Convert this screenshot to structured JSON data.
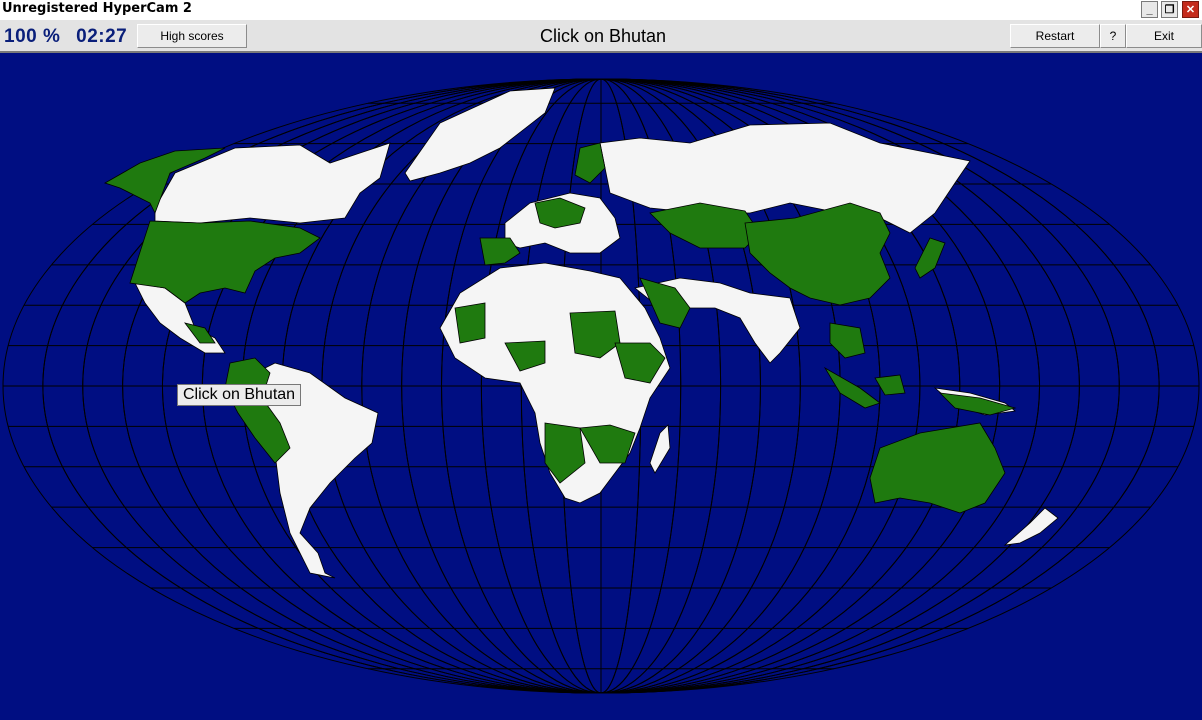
{
  "window": {
    "title": "Unregistered HyperCam 2"
  },
  "toolbar": {
    "score_percent": "100 %",
    "timer": "02:27",
    "high_scores_label": "High scores",
    "prompt": "Click on Bhutan",
    "restart_label": "Restart",
    "help_label": "?",
    "exit_label": "Exit"
  },
  "map": {
    "tooltip": "Click on Bhutan",
    "ocean_color": "#000e82",
    "found_color": "#1f7a0f",
    "unfound_color": "#f5f5f5"
  }
}
